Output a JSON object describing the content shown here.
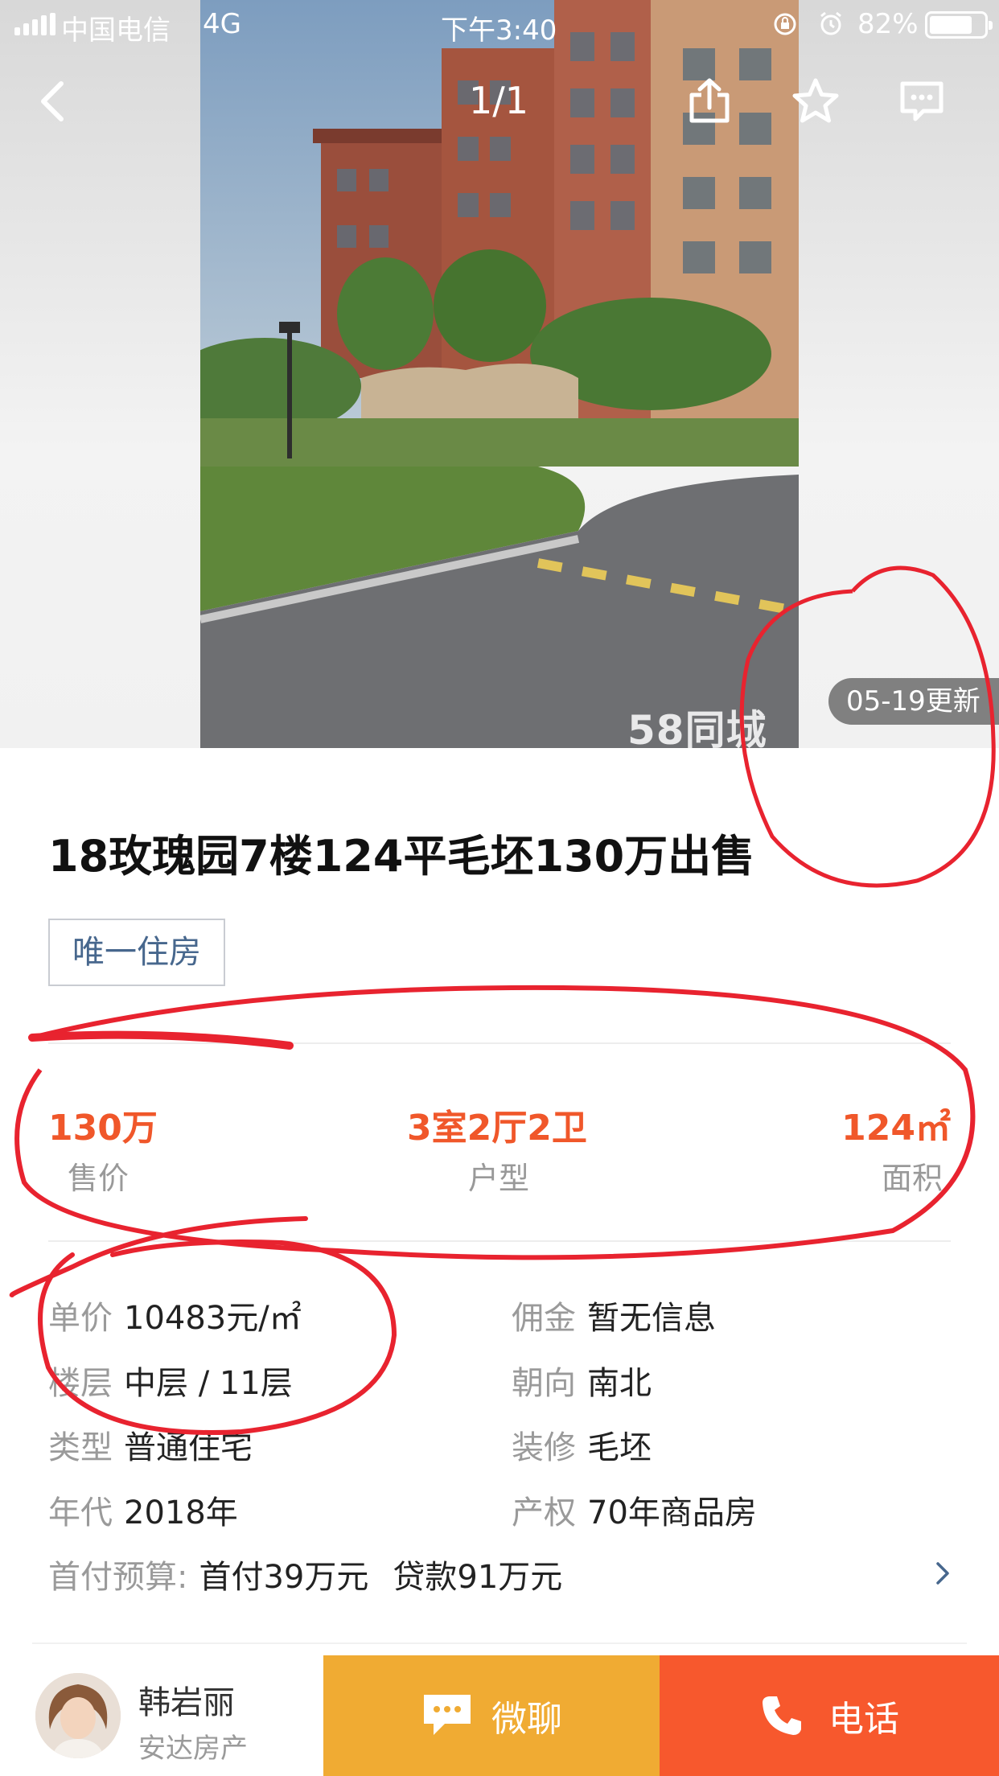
{
  "status_bar": {
    "carrier": "中国电信",
    "network": "4G",
    "time": "下午3:40",
    "battery": "82%"
  },
  "gallery": {
    "counter": "1/1",
    "watermark": "58同城",
    "update_badge": "05-19更新"
  },
  "nav_icons": [
    "back-icon",
    "share-icon",
    "star-icon",
    "message-icon"
  ],
  "listing": {
    "title": "18玫瑰园7楼124平毛坯130万出售",
    "tag": "唯一住房"
  },
  "key_info": [
    {
      "value": "130万",
      "label": "售价"
    },
    {
      "value": "3室2厅2卫",
      "label": "户型"
    },
    {
      "value": "124㎡",
      "label": "面积"
    }
  ],
  "attributes": [
    {
      "label": "单价",
      "value": "10483元/㎡"
    },
    {
      "label": "佣金",
      "value": "暂无信息"
    },
    {
      "label": "楼层",
      "value": "中层 / 11层"
    },
    {
      "label": "朝向",
      "value": "南北"
    },
    {
      "label": "类型",
      "value": "普通住宅"
    },
    {
      "label": "装修",
      "value": "毛坯"
    },
    {
      "label": "年代",
      "value": "2018年"
    },
    {
      "label": "产权",
      "value": "70年商品房"
    }
  ],
  "budget": {
    "label": "首付预算:",
    "down_payment": "首付39万元",
    "loan": "贷款91万元"
  },
  "agent": {
    "name": "韩岩丽",
    "company": "安达房产"
  },
  "actions": {
    "wechat_label": "微聊",
    "call_label": "电话"
  },
  "colors": {
    "accent_orange": "#f0572a",
    "wechat_button": "#f0ab33",
    "call_button": "#f7582d",
    "annotation_red": "#e8232f"
  }
}
